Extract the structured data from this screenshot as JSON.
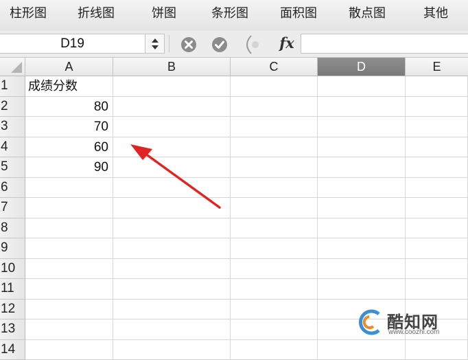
{
  "chart_toolbar": {
    "items": [
      {
        "label": "柱形图"
      },
      {
        "label": "折线图"
      },
      {
        "label": "饼图"
      },
      {
        "label": "条形图"
      },
      {
        "label": "面积图"
      },
      {
        "label": "散点图"
      },
      {
        "label": "其他"
      }
    ]
  },
  "formula_bar": {
    "name_box": "D19",
    "fx_label": "fx",
    "formula_value": "",
    "icons": [
      "stepper-icon",
      "cancel-icon",
      "confirm-icon",
      "function-icon"
    ]
  },
  "sheet": {
    "columns": [
      "A",
      "B",
      "C",
      "D",
      "E"
    ],
    "selected_column": "D",
    "rows": [
      {
        "num": "1",
        "A": "成绩分数"
      },
      {
        "num": "2",
        "A": "80"
      },
      {
        "num": "3",
        "A": "70"
      },
      {
        "num": "4",
        "A": "60"
      },
      {
        "num": "5",
        "A": "90"
      },
      {
        "num": "6",
        "A": ""
      },
      {
        "num": "7",
        "A": ""
      },
      {
        "num": "8",
        "A": ""
      },
      {
        "num": "9",
        "A": ""
      },
      {
        "num": "10",
        "A": ""
      },
      {
        "num": "11",
        "A": ""
      },
      {
        "num": "12",
        "A": ""
      },
      {
        "num": "13",
        "A": ""
      },
      {
        "num": "14",
        "A": ""
      }
    ]
  },
  "annotation": {
    "color": "#e02424"
  },
  "watermark": {
    "name": "酷知网",
    "url": "www.coozhi.com",
    "logo_colors": [
      "#3b8fd6",
      "#f08a24"
    ]
  }
}
